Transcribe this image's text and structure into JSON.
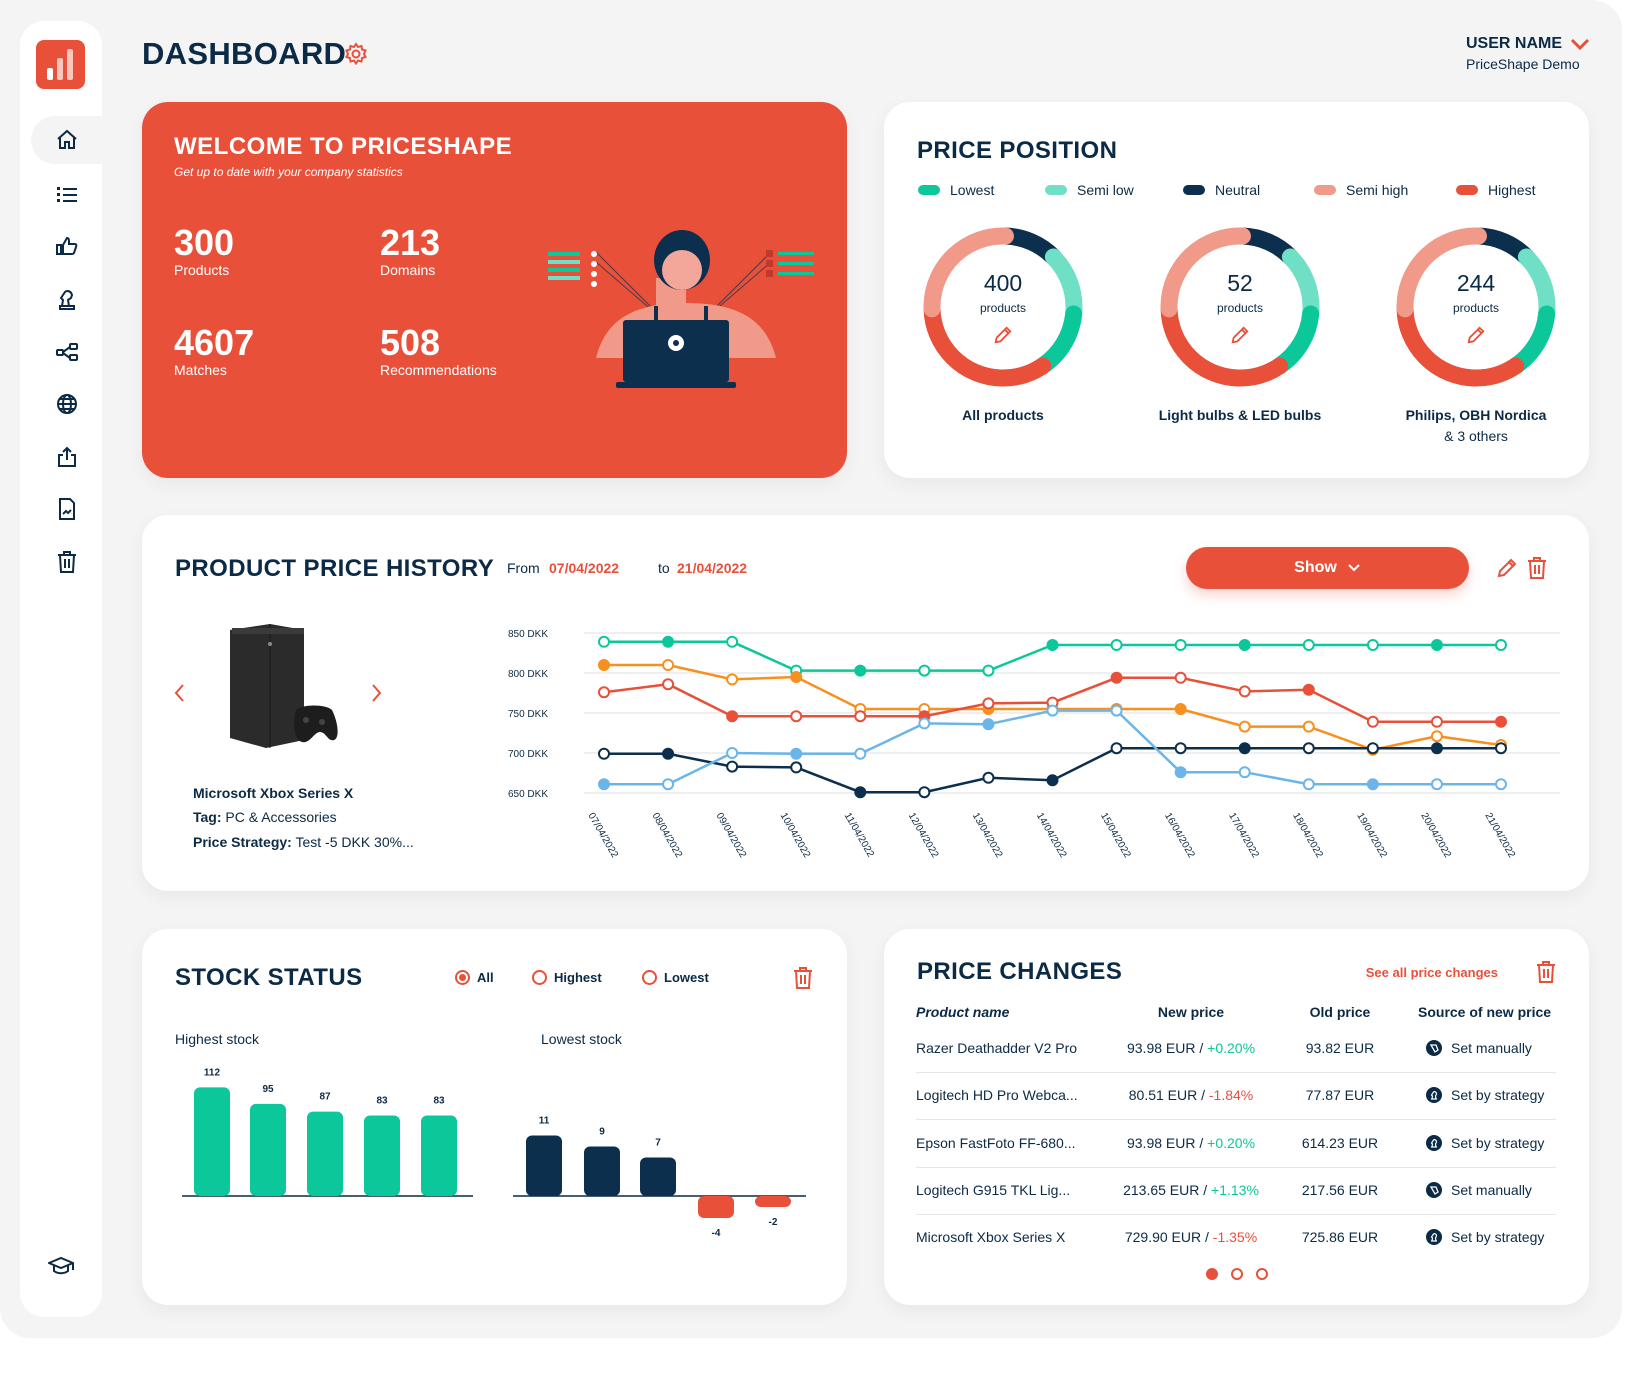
{
  "header": {
    "title": "DASHBOARD",
    "user_name": "USER NAME",
    "company": "PriceShape Demo"
  },
  "sidebar": {
    "items": [
      {
        "icon": "home-icon",
        "active": true
      },
      {
        "icon": "list-icon"
      },
      {
        "icon": "thumbs-up-icon"
      },
      {
        "icon": "chess-knight-icon"
      },
      {
        "icon": "share-nodes-icon"
      },
      {
        "icon": "globe-icon"
      },
      {
        "icon": "upload-icon"
      },
      {
        "icon": "report-file-icon"
      },
      {
        "icon": "trash-icon"
      }
    ],
    "bottom_icon": "graduation-cap-icon"
  },
  "welcome": {
    "title": "WELCOME TO PRICESHAPE",
    "subtitle": "Get up to date with your company statistics",
    "stats": [
      {
        "value": "300",
        "label": "Products"
      },
      {
        "value": "213",
        "label": "Domains"
      },
      {
        "value": "4607",
        "label": "Matches"
      },
      {
        "value": "508",
        "label": "Recommendations"
      }
    ]
  },
  "price_position": {
    "title": "PRICE POSITION",
    "legend": [
      {
        "label": "Lowest",
        "color": "#0bc79a"
      },
      {
        "label": "Semi low",
        "color": "#6fdfc6"
      },
      {
        "label": "Neutral",
        "color": "#0b2f4d"
      },
      {
        "label": "Semi high",
        "color": "#f19a89"
      },
      {
        "label": "Highest",
        "color": "#e8503a"
      }
    ],
    "donuts": [
      {
        "count": "400",
        "unit": "products",
        "label": "All products",
        "sublabel": "",
        "segments_percent": {
          "Neutral": 12,
          "Semi low": 14,
          "Lowest": 14,
          "Highest": 34,
          "Semi high": 26
        }
      },
      {
        "count": "52",
        "unit": "products",
        "label": "Light bulbs & LED bulbs",
        "sublabel": "",
        "segments_percent": {
          "Neutral": 12,
          "Semi low": 14,
          "Lowest": 14,
          "Highest": 34,
          "Semi high": 26
        }
      },
      {
        "count": "244",
        "unit": "products",
        "label": "Philips, OBH Nordica",
        "sublabel": "& 3 others",
        "segments_percent": {
          "Neutral": 12,
          "Semi low": 14,
          "Lowest": 14,
          "Highest": 34,
          "Semi high": 26
        }
      }
    ]
  },
  "price_history": {
    "title": "PRODUCT PRICE HISTORY",
    "from_label": "From",
    "from_date": "07/04/2022",
    "to_label": "to",
    "to_date": "21/04/2022",
    "show_button": "Show",
    "product": {
      "name": "Microsoft Xbox Series X",
      "tag_label": "Tag:",
      "tag": "PC & Accessories",
      "strategy_label": "Price Strategy:",
      "strategy": "Test -5 DKK 30%..."
    }
  },
  "stock": {
    "title": "STOCK STATUS",
    "filters": [
      {
        "label": "All",
        "selected": true
      },
      {
        "label": "Highest",
        "selected": false
      },
      {
        "label": "Lowest",
        "selected": false
      }
    ],
    "highest_title": "Highest stock",
    "lowest_title": "Lowest stock"
  },
  "price_changes": {
    "title": "PRICE CHANGES",
    "see_all": "See all price changes",
    "columns": [
      "Product name",
      "New price",
      "Old price",
      "Source of new price"
    ],
    "rows": [
      {
        "name": "Razer Deathadder V2 Pro",
        "new": "93.98 EUR / ",
        "change": "+0.20%",
        "change_color": "#0bc79a",
        "old": "93.82 EUR",
        "source": "Set manually",
        "icon": "tag-icon"
      },
      {
        "name": "Logitech HD Pro Webca...",
        "new": "80.51 EUR / ",
        "change": "-1.84%",
        "change_color": "#e8503a",
        "old": "77.87 EUR",
        "source": "Set by strategy",
        "icon": "chess-knight-icon"
      },
      {
        "name": "Epson FastFoto FF-680...",
        "new": "93.98 EUR / ",
        "change": "+0.20%",
        "change_color": "#0bc79a",
        "old": "614.23 EUR",
        "source": "Set by strategy",
        "icon": "chess-knight-icon"
      },
      {
        "name": "Logitech G915 TKL Lig...",
        "new": "213.65 EUR / ",
        "change": "+1.13%",
        "change_color": "#0bc79a",
        "old": "217.56 EUR",
        "source": "Set manually",
        "icon": "tag-icon"
      },
      {
        "name": "Microsoft Xbox Series X",
        "new": "729.90 EUR / ",
        "change": "-1.35%",
        "change_color": "#e8503a",
        "old": "725.86 EUR",
        "source": "Set by strategy",
        "icon": "chess-knight-icon"
      }
    ],
    "pagination": {
      "pages": 3,
      "current": 1
    }
  },
  "chart_data": [
    {
      "type": "line",
      "xlabel": "",
      "ylabel": "",
      "ylim": [
        650,
        850
      ],
      "grid": true,
      "yticks": [
        "850 DKK",
        "800 DKK",
        "750 DKK",
        "700 DKK",
        "650 DKK"
      ],
      "x": [
        "07/04/2022",
        "08/04/2022",
        "09/04/2022",
        "10/04/2022",
        "11/04/2022",
        "12/04/2022",
        "13/04/2022",
        "14/04/2022",
        "15/04/2022",
        "16/04/2022",
        "17/04/2022",
        "18/04/2022",
        "19/04/2022",
        "20/04/2022",
        "21/04/2022"
      ],
      "series": [
        {
          "color": "#0bc79a",
          "values": [
            839,
            839,
            839,
            803,
            803,
            803,
            803,
            835,
            835,
            835,
            835,
            835,
            835,
            835,
            835
          ]
        },
        {
          "color": "#f7901e",
          "values": [
            810,
            810,
            792,
            795,
            755,
            755,
            755,
            755,
            755,
            755,
            733,
            733,
            704,
            721,
            710
          ]
        },
        {
          "color": "#e8503a",
          "values": [
            776,
            786,
            746,
            746,
            746,
            746,
            762,
            763,
            794,
            794,
            777,
            779,
            739,
            739,
            739
          ]
        },
        {
          "color": "#0b2f4d",
          "values": [
            699,
            699,
            683,
            682,
            651,
            651,
            669,
            666,
            706,
            706,
            706,
            706,
            706,
            706,
            706
          ]
        },
        {
          "color": "#6bb5e8",
          "values": [
            661,
            661,
            700,
            699,
            699,
            737,
            736,
            753,
            753,
            676,
            676,
            661,
            661,
            661,
            661
          ]
        }
      ]
    },
    {
      "type": "bar",
      "title": "Highest stock",
      "values": [
        112,
        95,
        87,
        83,
        83
      ],
      "color": "#0bc79a"
    },
    {
      "type": "bar",
      "title": "Lowest stock",
      "values": [
        11,
        9,
        7,
        -4,
        -2
      ],
      "colors": {
        "positive": "#0b2f4d",
        "negative": "#e8503a"
      }
    }
  ]
}
